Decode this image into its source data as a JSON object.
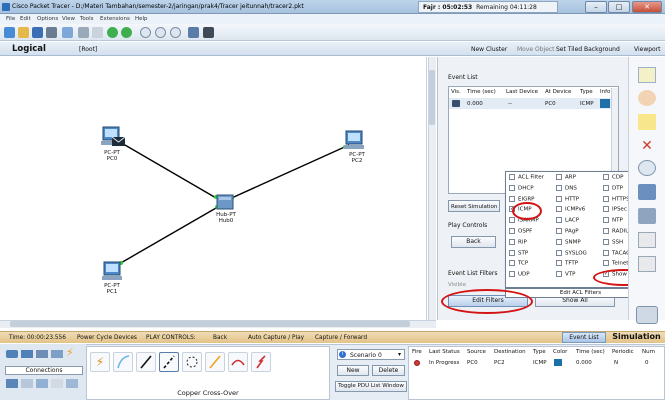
{
  "window": {
    "title": "Cisco Packet Tracer - D:/Materi Tambahan/semester-2/jaringan/prak4/Tracer jeitunnah/tracer2.pkt",
    "timer_fajr": "Fajr : 05:02:53",
    "timer_remaining": "Remaining 04:11:28"
  },
  "menu": [
    "File",
    "Edit",
    "Options",
    "View",
    "Tools",
    "Extensions",
    "Help"
  ],
  "logical_bar": {
    "logical": "Logical",
    "root": "[Root]",
    "new_cluster": "New Cluster",
    "move_object": "Move Object",
    "set_tiled": "Set Tiled Background",
    "viewport": "Viewport"
  },
  "devices": [
    {
      "type": "PC-PT",
      "name": "PC0"
    },
    {
      "type": "PC-PT",
      "name": "PC2"
    },
    {
      "type": "Hub-PT",
      "name": "Hub0"
    },
    {
      "type": "PC-PT",
      "name": "PC1"
    }
  ],
  "sim_panel": {
    "event_list_title": "Event List",
    "columns": [
      "Vis.",
      "Time (sec)",
      "Last Device",
      "At Device",
      "Type",
      "Info"
    ],
    "rows": [
      {
        "time": "0.000",
        "last": "--",
        "at": "PC0",
        "type": "ICMP"
      }
    ],
    "reset_simulation": "Reset Simulation",
    "play_controls": "Play Controls",
    "back": "Back",
    "event_list_filters": "Event List Filters",
    "visible": "Visible",
    "edit_filters": "Edit Filters",
    "show_all": "Show All"
  },
  "filter_popup": {
    "col1": [
      {
        "label": "ACL Filter",
        "checked": false
      },
      {
        "label": "DHCP",
        "checked": false
      },
      {
        "label": "EIGRP",
        "checked": false
      },
      {
        "label": "ICMP",
        "checked": true
      },
      {
        "label": "ISAKMP",
        "checked": false
      },
      {
        "label": "OSPF",
        "checked": false
      },
      {
        "label": "RIP",
        "checked": false
      },
      {
        "label": "STP",
        "checked": false
      },
      {
        "label": "TCP",
        "checked": false
      },
      {
        "label": "UDP",
        "checked": false
      }
    ],
    "col2": [
      {
        "label": "ARP",
        "checked": false
      },
      {
        "label": "DNS",
        "checked": false
      },
      {
        "label": "HTTP",
        "checked": false
      },
      {
        "label": "ICMPv6",
        "checked": false
      },
      {
        "label": "LACP",
        "checked": false
      },
      {
        "label": "PAgP",
        "checked": false
      },
      {
        "label": "SNMP",
        "checked": false
      },
      {
        "label": "SYSLOG",
        "checked": false
      },
      {
        "label": "TFTP",
        "checked": false
      },
      {
        "label": "VTP",
        "checked": false
      }
    ],
    "col3": [
      {
        "label": "CDP",
        "checked": false
      },
      {
        "label": "DTP",
        "checked": false
      },
      {
        "label": "HTTPS",
        "checked": false
      },
      {
        "label": "IPSec",
        "checked": false
      },
      {
        "label": "NTP",
        "checked": false
      },
      {
        "label": "RADIUS",
        "checked": false
      },
      {
        "label": "SSH",
        "checked": false
      },
      {
        "label": "TACACS",
        "checked": false
      },
      {
        "label": "Telnet",
        "checked": false
      },
      {
        "label": "Show All/None",
        "checked": true
      }
    ],
    "edit_acl_filters": "Edit ACL Filters"
  },
  "status_bar": {
    "time": "Time: 00:00:23.556",
    "power_cycle": "Power Cycle Devices",
    "play_controls": "PLAY CONTROLS:",
    "back": "Back",
    "auto_capture": "Auto Capture / Play",
    "capture_forward": "Capture / Forward",
    "event_list_tab": "Event List",
    "simulation_tab": "Simulation"
  },
  "bottom": {
    "connections": "Connections",
    "cable_name": "Copper Cross-Over",
    "scenario": "Scenario 0",
    "new": "New",
    "delete": "Delete",
    "toggle_pdu": "Toggle PDU List Window",
    "pdu_columns": [
      "Fire",
      "Last Status",
      "Source",
      "Destination",
      "Type",
      "Color",
      "Time (sec)",
      "Periodic",
      "Num"
    ],
    "pdu_row": {
      "status": "In Progress",
      "source": "PC0",
      "dest": "PC2",
      "type": "ICMP",
      "time": "0.000",
      "periodic": "N",
      "num": "0"
    }
  },
  "colors": {
    "highlight_red": "#d41414",
    "status_bar": "#e2c288",
    "accent_blue": "#2c6eb7",
    "icmp_color": "#1f6fa8"
  }
}
